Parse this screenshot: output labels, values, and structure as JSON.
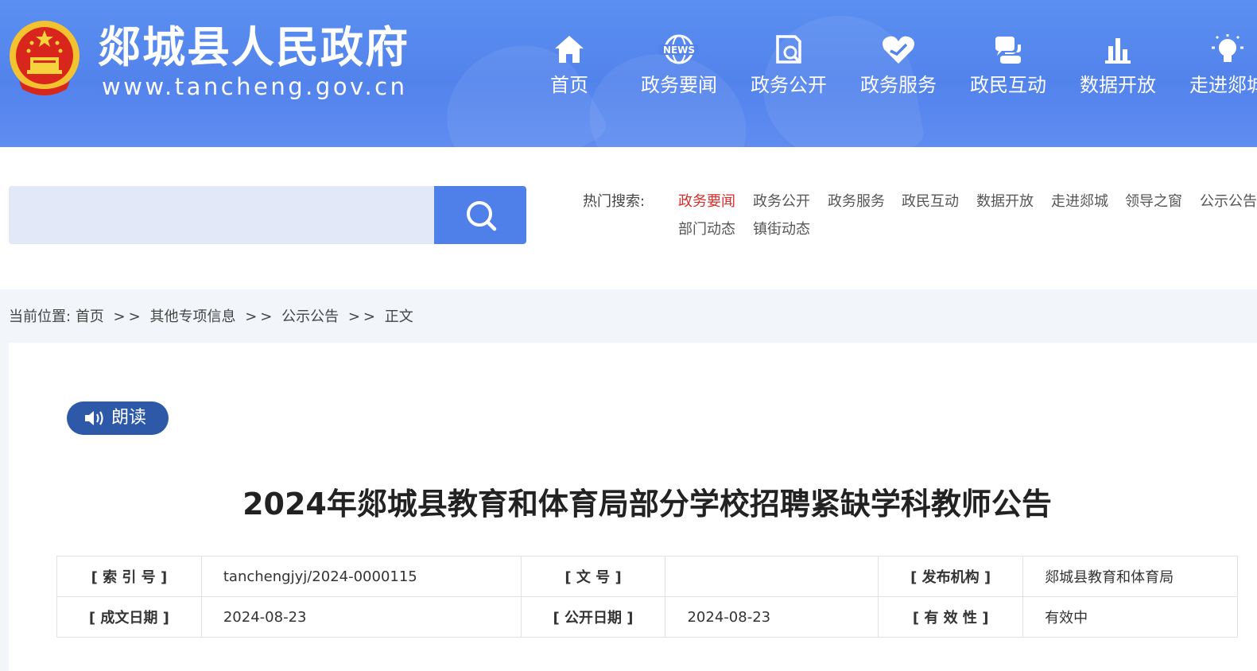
{
  "header": {
    "site_title": "郯城县人民政府",
    "site_url": "www.tancheng.gov.cn",
    "nav": [
      {
        "label": "首页",
        "icon": "home-icon"
      },
      {
        "label": "政务要闻",
        "icon": "news-icon"
      },
      {
        "label": "政务公开",
        "icon": "open-affairs-icon"
      },
      {
        "label": "政务服务",
        "icon": "heart-service-icon"
      },
      {
        "label": "政民互动",
        "icon": "interaction-icon"
      },
      {
        "label": "数据开放",
        "icon": "bar-chart-icon"
      },
      {
        "label": "走进郯城",
        "icon": "lightbulb-icon"
      }
    ]
  },
  "search": {
    "placeholder": "",
    "hot_label": "热门搜索:",
    "hot_links": [
      "政务要闻",
      "政务公开",
      "政务服务",
      "政民互动",
      "数据开放",
      "走进郯城",
      "领导之窗",
      "公示公告",
      "部门动态",
      "镇街动态"
    ]
  },
  "breadcrumb": {
    "prefix": "当前位置:",
    "items": [
      "首页",
      "其他专项信息",
      "公示公告",
      "正文"
    ],
    "separator": ">>"
  },
  "article": {
    "read_aloud": "朗读",
    "title": "2024年郯城县教育和体育局部分学校招聘紧缺学科教师公告",
    "meta": {
      "index_label": "[ 索 引 号 ]",
      "index_value": "tanchengjyj/2024-0000115",
      "doc_no_label": "[ 文 号 ]",
      "doc_no_value": "",
      "publisher_label": "[ 发布机构 ]",
      "publisher_value": "郯城县教育和体育局",
      "created_label": "[ 成文日期 ]",
      "created_value": "2024-08-23",
      "published_label": "[ 公开日期 ]",
      "published_value": "2024-08-23",
      "validity_label": "[ 有 效 性 ]",
      "validity_value": "有效中"
    }
  },
  "colors": {
    "header_blue": "#5283ec",
    "search_button": "#4f80ea",
    "search_bg": "#e2e8f7",
    "hot_active": "#d92d2d",
    "read_button": "#2d59a8"
  }
}
